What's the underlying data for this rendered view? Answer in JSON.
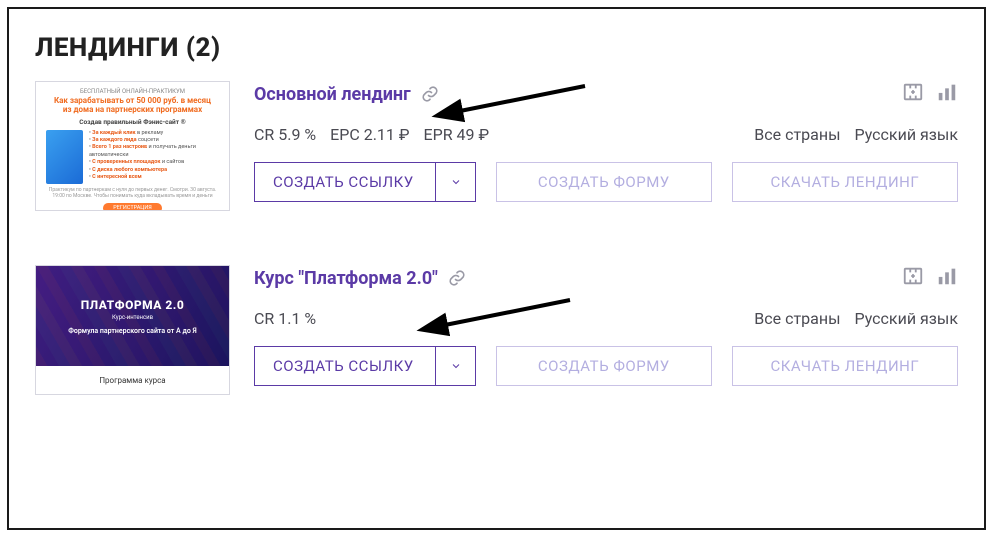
{
  "heading": "ЛЕНДИНГИ (2)",
  "landings": [
    {
      "title": "Основной лендинг",
      "metrics": {
        "cr": "CR 5.9 %",
        "epc": "EPC 2.11 ₽",
        "epr": "EPR 49 ₽"
      },
      "tags": {
        "countries": "Все страны",
        "language": "Русский язык"
      },
      "buttons": {
        "create_link": "СОЗДАТЬ ССЫЛКУ",
        "create_form": "СОЗДАТЬ ФОРМУ",
        "download": "СКАЧАТЬ ЛЕНДИНГ"
      },
      "thumb": {
        "line1": "БЕСПЛАТНЫЙ ОНЛАЙН-ПРАКТИКУМ",
        "line2": "Как зарабатывать от 50 000 руб. в месяц",
        "line3": "из дома на партнерских программах",
        "line4": "Создав правильный Фэнис-сайт ®",
        "bullets": [
          "За каждый клик",
          "За каждого лида",
          "Всего 1 раз настроив",
          "С проверенных площадок",
          "С диска любого компьютера",
          "С интересной всем"
        ],
        "foot": "Практикум по партнеркам с нуля до первых денег. Смотри. 30 августа. 19:00 по Москве. Чтобы понимать куда вкладывать время и деньги",
        "cta": "РЕГИСТРАЦИЯ"
      }
    },
    {
      "title": "Курс \"Платформа 2.0\"",
      "metrics": {
        "cr": "CR 1.1 %",
        "epc": "",
        "epr": ""
      },
      "tags": {
        "countries": "Все страны",
        "language": "Русский язык"
      },
      "buttons": {
        "create_link": "СОЗДАТЬ ССЫЛКУ",
        "create_form": "СОЗДАТЬ ФОРМУ",
        "download": "СКАЧАТЬ ЛЕНДИНГ"
      },
      "thumb": {
        "p1": "ПЛАТФОРМА 2.0",
        "p2": "Курс-интенсив",
        "p3": "Формула партнерского сайта от А до Я",
        "lower": "Программа курса"
      }
    }
  ]
}
